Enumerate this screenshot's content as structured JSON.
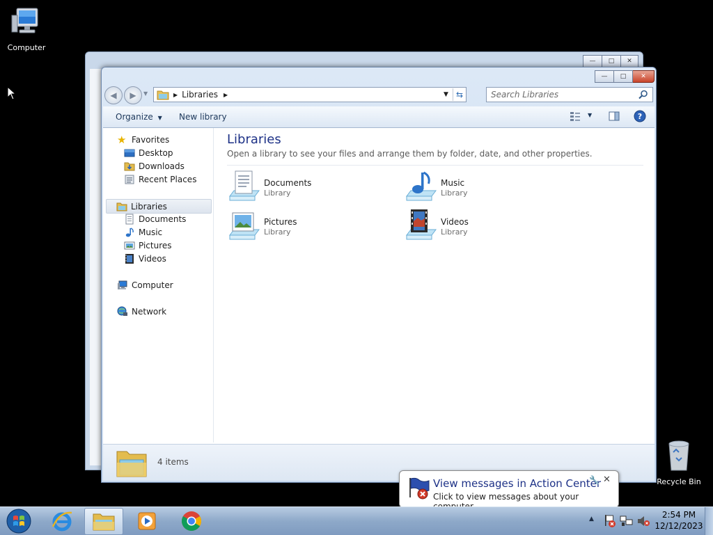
{
  "desktop": {
    "icons": [
      {
        "label": "Computer",
        "icon": "computer-icon"
      },
      {
        "label": "Recycle Bin",
        "icon": "recycle-bin-icon"
      }
    ]
  },
  "explorer": {
    "address": {
      "crumb": "Libraries"
    },
    "search": {
      "placeholder": "Search Libraries"
    },
    "toolbar": {
      "organize": "Organize",
      "new_library": "New library"
    },
    "nav": {
      "favorites": {
        "label": "Favorites",
        "items": [
          "Desktop",
          "Downloads",
          "Recent Places"
        ]
      },
      "libraries": {
        "label": "Libraries",
        "items": [
          "Documents",
          "Music",
          "Pictures",
          "Videos"
        ]
      },
      "computer": "Computer",
      "network": "Network"
    },
    "main": {
      "title": "Libraries",
      "subtitle": "Open a library to see your files and arrange them by folder, date, and other properties.",
      "tiles": [
        {
          "name": "Documents",
          "kind": "Library",
          "icon": "documents-library-icon"
        },
        {
          "name": "Music",
          "kind": "Library",
          "icon": "music-library-icon"
        },
        {
          "name": "Pictures",
          "kind": "Library",
          "icon": "pictures-library-icon"
        },
        {
          "name": "Videos",
          "kind": "Library",
          "icon": "videos-library-icon"
        }
      ]
    },
    "status": {
      "count": "4 items"
    }
  },
  "balloon": {
    "title": "View messages in Action Center",
    "body": "Click to view messages about your computer."
  },
  "taskbar": {
    "apps": [
      "start-orb",
      "internet-explorer",
      "windows-explorer",
      "windows-media-player",
      "google-chrome"
    ],
    "clock": {
      "time": "2:54 PM",
      "date": "12/12/2023"
    }
  },
  "colors": {
    "title_blue": "#1e3287",
    "taskbar": "#8ea9c9",
    "desktop": "#000000"
  }
}
